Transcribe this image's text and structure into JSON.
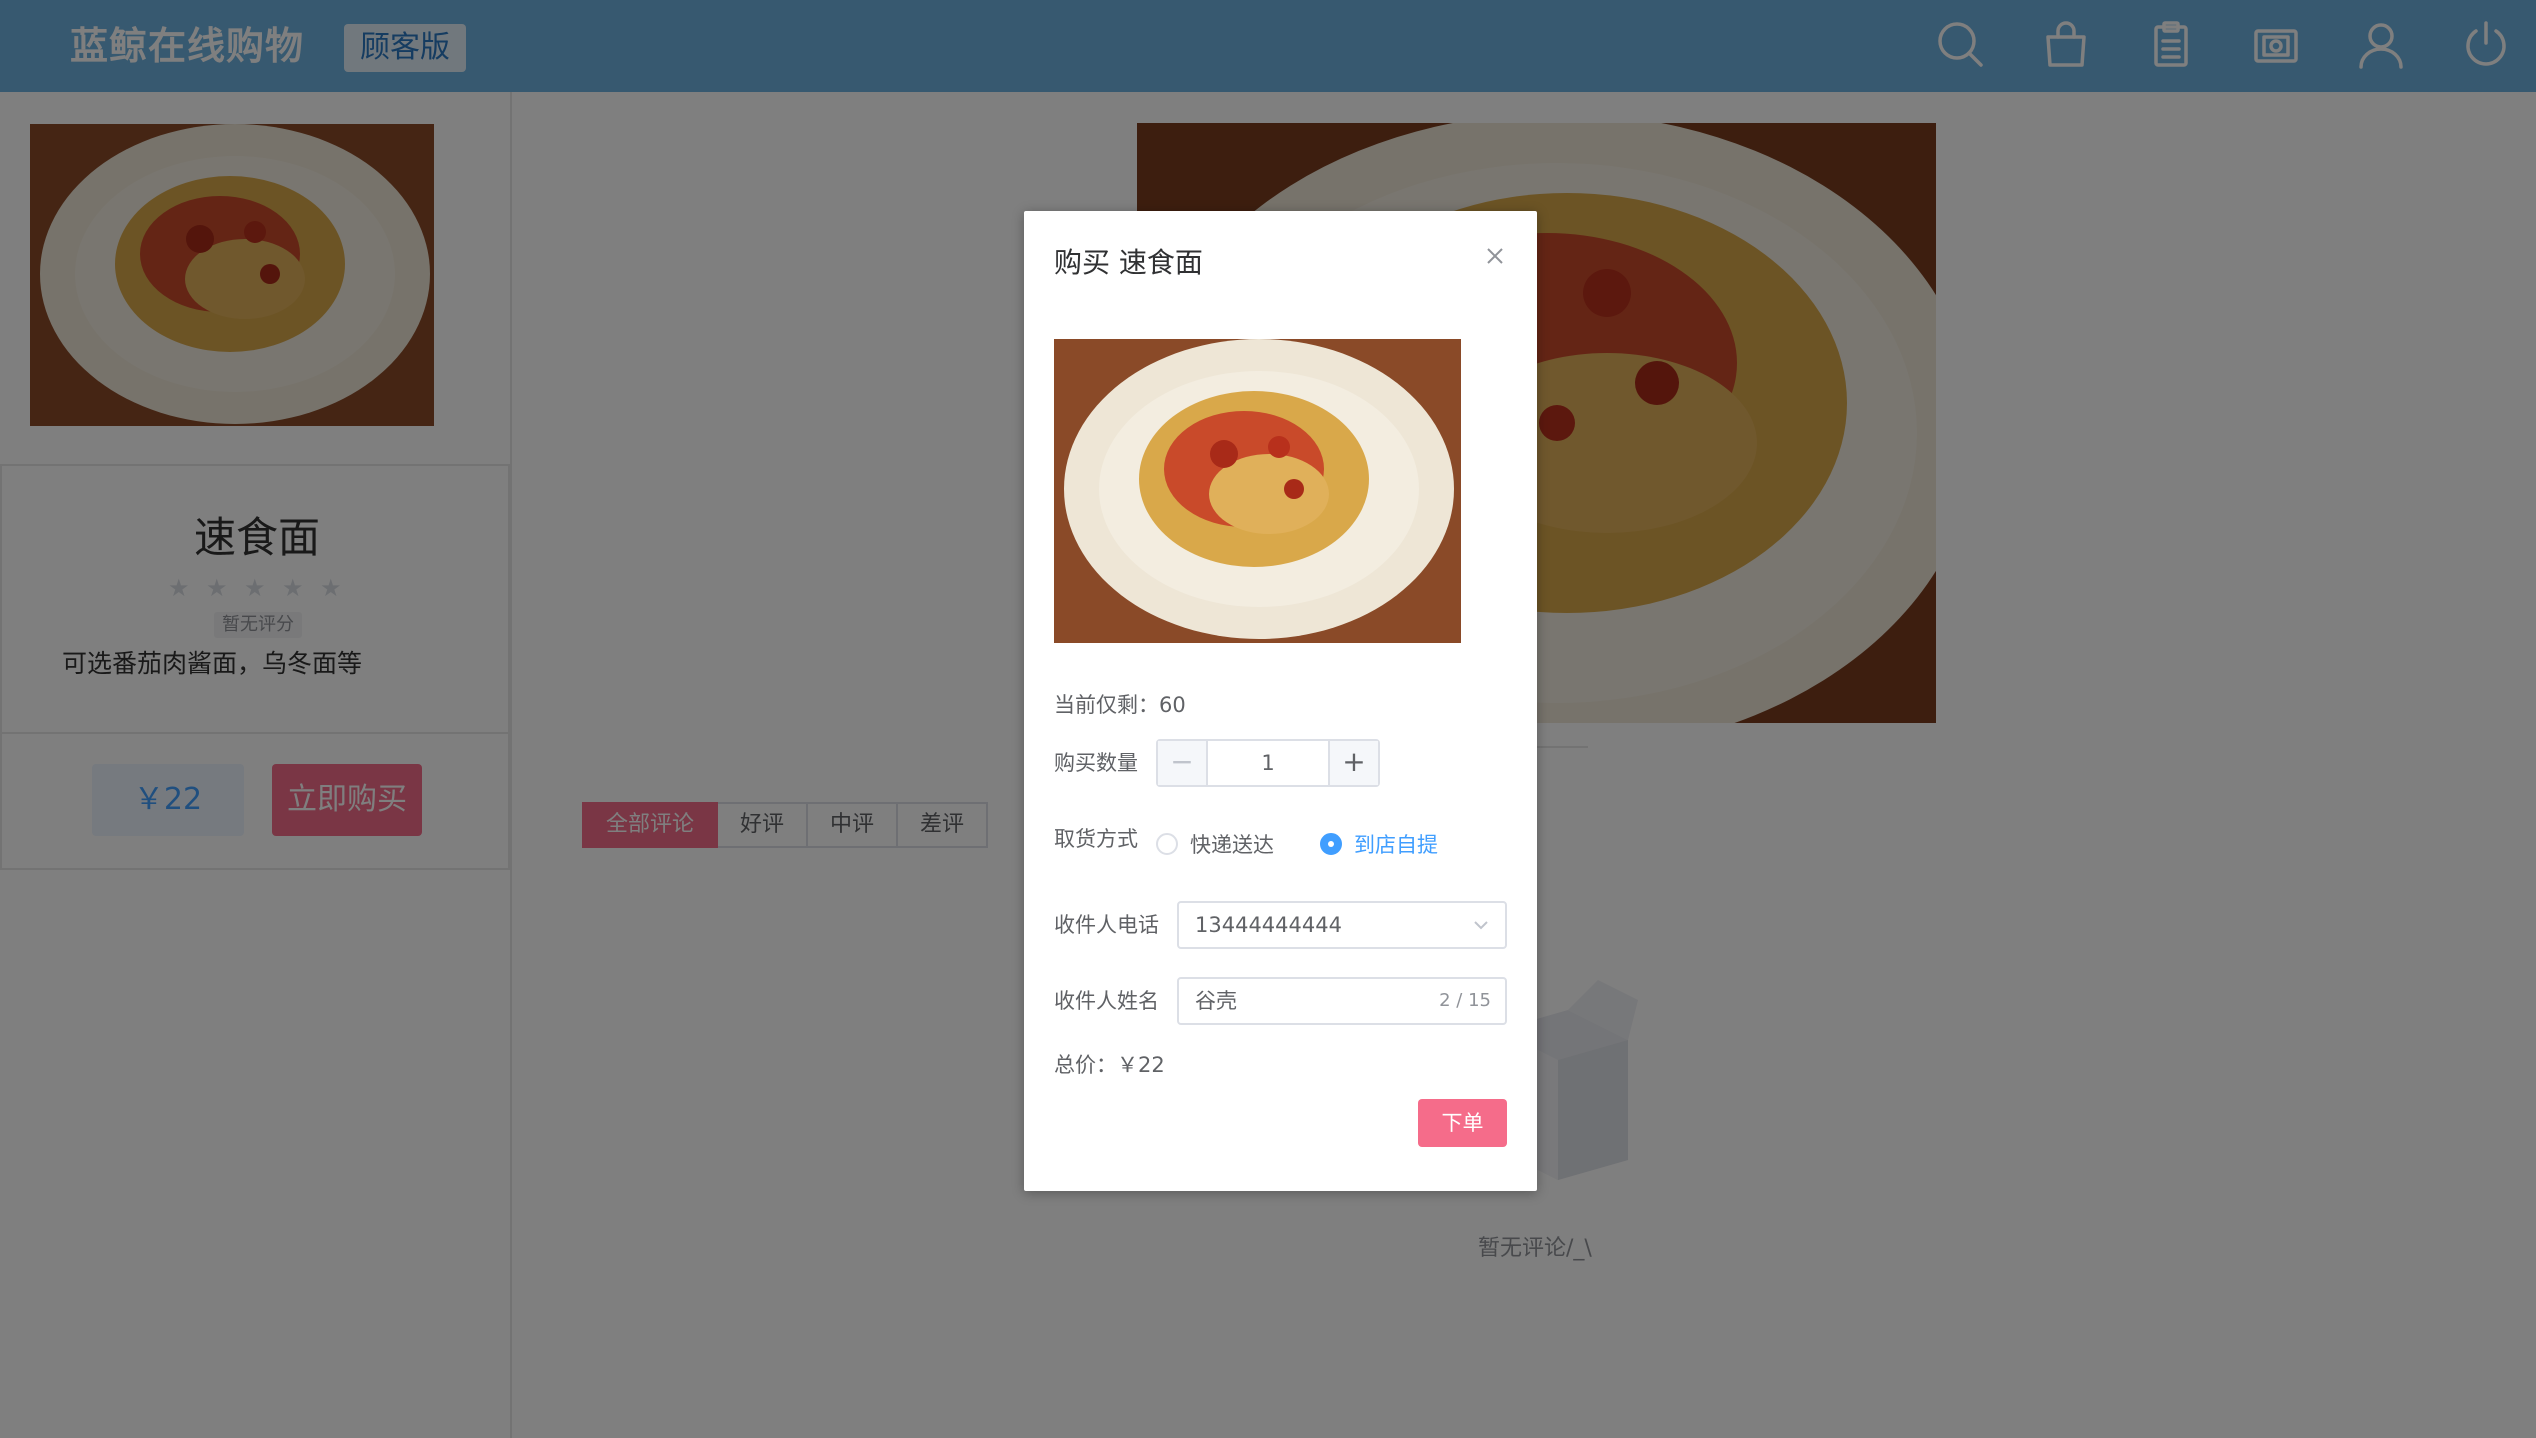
{
  "header": {
    "brand": "蓝鲸在线购物",
    "edition": "顾客版",
    "icons": [
      "search-icon",
      "bag-icon",
      "clipboard-icon",
      "wallet-icon",
      "user-icon",
      "power-icon"
    ]
  },
  "product": {
    "name": "速食面",
    "rating_text": "暂无评分",
    "description": "可选番茄肉酱面，乌冬面等",
    "price": "￥22",
    "buy_now": "立即购买"
  },
  "reviews": {
    "tabs": [
      "全部评论",
      "好评",
      "中评",
      "差评"
    ],
    "active_tab": 0,
    "empty_text": "暂无评论/_\\"
  },
  "dialog": {
    "title": "购买 速食面",
    "stock_label": "当前仅剩：60",
    "quantity_label": "购买数量",
    "quantity": "1",
    "delivery_label": "取货方式",
    "delivery_options": [
      "快递送达",
      "到店自提"
    ],
    "delivery_selected": 1,
    "phone_label": "收件人电话",
    "phone_value": "13444444444",
    "name_label": "收件人姓名",
    "name_value": "谷壳",
    "name_count": "2 / 15",
    "total": "总价：￥22",
    "submit": "下单"
  },
  "colors": {
    "header_bg": "#6fb3e0",
    "accent_pink": "#f56c8a",
    "accent_blue": "#409eff"
  }
}
